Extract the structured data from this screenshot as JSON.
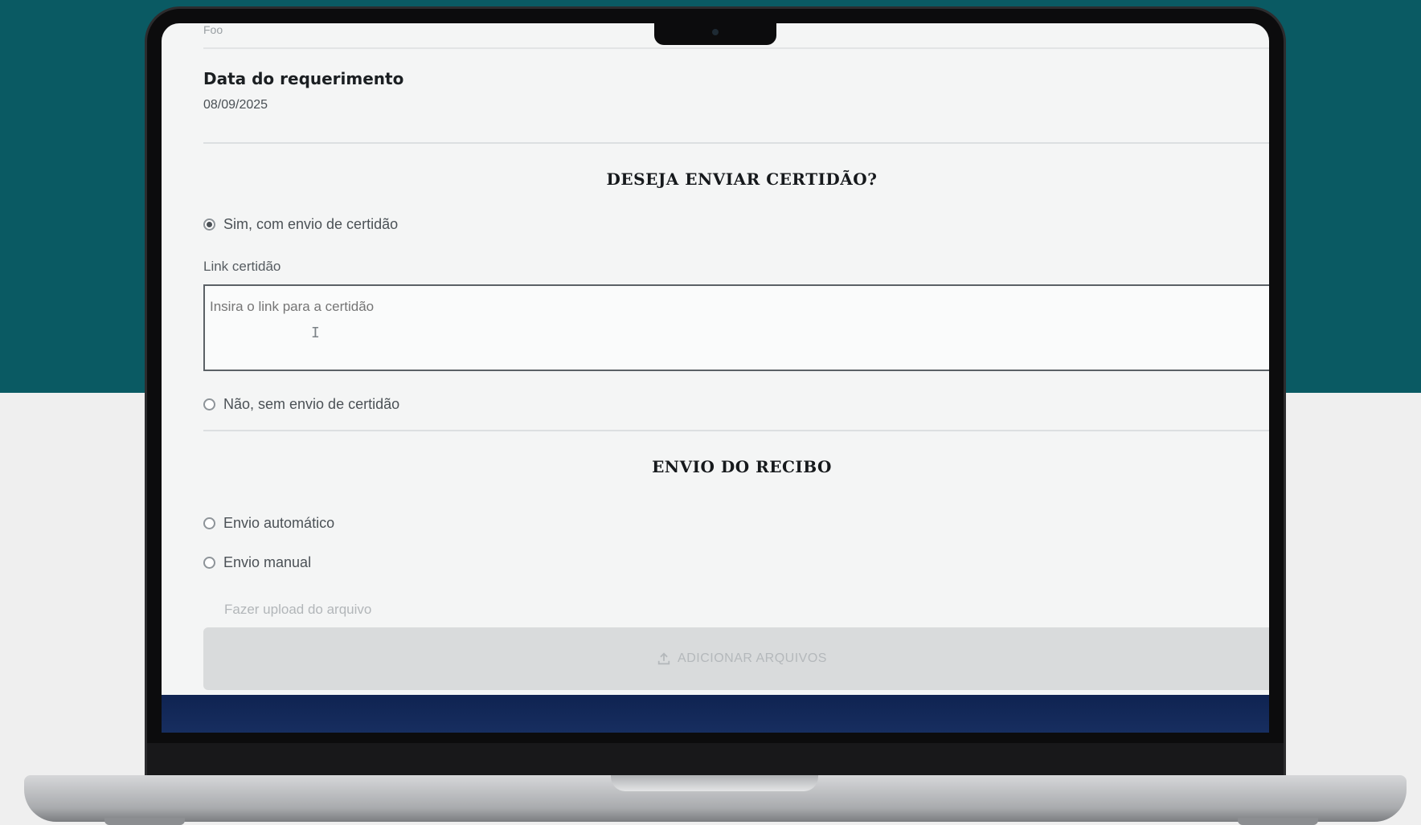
{
  "form": {
    "cut_off_text": "Foo",
    "date_label": "Data do requerimento",
    "date_value": "08/09/2025",
    "certidao": {
      "title": "DESEJA ENVIAR CERTIDÃO?",
      "option_yes": "Sim, com envio de certidão",
      "option_no": "Não, sem envio de certidão",
      "selected": "yes",
      "link_label": "Link certidão",
      "link_placeholder": "Insira o link para a certidão"
    },
    "recibo": {
      "title": "ENVIO DO RECIBO",
      "option_auto": "Envio automático",
      "option_manual": "Envio manual",
      "manual_hint": "Fazer upload do arquivo",
      "upload_button": "ADICIONAR ARQUIVOS",
      "upload_icon": "upload-icon"
    }
  },
  "colors": {
    "background_top": "#0a5a63",
    "footer_bar": "#0f2351"
  }
}
